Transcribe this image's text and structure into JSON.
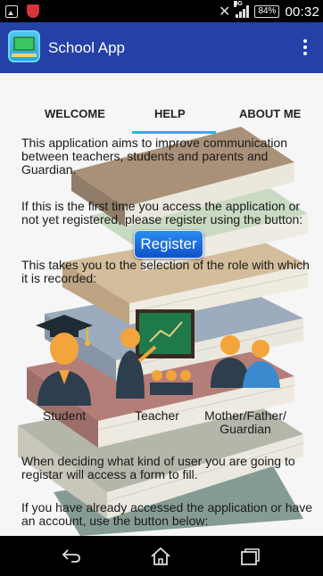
{
  "status_bar": {
    "network": "4G",
    "battery": "84%",
    "time": "00:32"
  },
  "app_bar": {
    "title": "School App",
    "logo_icon": "classroom-board-icon",
    "menu_icon": "overflow-menu-icon"
  },
  "tabs": [
    {
      "label": "WELCOME",
      "active": false
    },
    {
      "label": "HELP",
      "active": true
    },
    {
      "label": "ABOUT ME",
      "active": false
    }
  ],
  "help": {
    "intro": "This application aims to improve communication between teachers, students and parents and Guardian.",
    "register_prompt": "If this is the first time you access the application or not yet registered, please register using the button:",
    "register_button": "Register",
    "role_intro": "This takes you to the selection of the role with which it is recorded:",
    "roles": [
      {
        "label": "Student",
        "icon": "student-graduate-icon"
      },
      {
        "label": "Teacher",
        "icon": "teacher-blackboard-icon"
      },
      {
        "label": "Mother/Father/ Guardian",
        "icon": "parents-icon"
      }
    ],
    "form_note": "When deciding what kind of user you are going to registar will access a form to fill.",
    "login_prompt": "If you have already accessed the application or have an account, use the button below:"
  },
  "nav_bar": {
    "back_icon": "back-icon",
    "home_icon": "home-icon",
    "recent_icon": "recent-apps-icon"
  },
  "colors": {
    "app_bar": "#2441a8",
    "tab_indicator": "#31b0e4",
    "register_button": "#1a6ee0"
  }
}
